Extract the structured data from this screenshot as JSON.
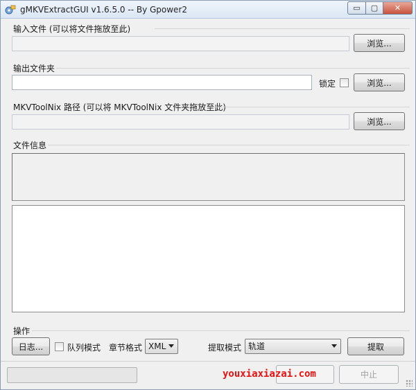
{
  "window": {
    "title": "gMKVExtractGUI v1.6.5.0 -- By Gpower2",
    "controls": {
      "minimize": "▭",
      "maximize": "▢",
      "close": "✕"
    }
  },
  "input_group": {
    "title": "输入文件 (可以将文件拖放至此)",
    "value": "",
    "browse": "浏览..."
  },
  "output_group": {
    "title": "输出文件夹",
    "value": "",
    "lock_label": "锁定",
    "lock_checked": false,
    "browse": "浏览..."
  },
  "mkvtoolnix_group": {
    "title": "MKVToolNix 路径 (可以将 MKVToolNix 文件夹拖放至此)",
    "value": "",
    "browse": "浏览..."
  },
  "file_info_group": {
    "title": "文件信息"
  },
  "actions_group": {
    "title": "操作",
    "log_button": "日志...",
    "queue_mode_label": "队列模式",
    "queue_mode_checked": false,
    "chapter_format_label": "章节格式",
    "chapter_format_value": "XML",
    "extract_mode_label": "提取模式",
    "extract_mode_value": "轨道",
    "extract_button": "提取"
  },
  "status_bar": {
    "progress": 0,
    "add_jobs_button": "",
    "abort_button": "中止",
    "watermark": "youxiaxiazai.com"
  },
  "colors": {
    "accent": "#06b025",
    "close": "#c7523c",
    "watermark": "#e8110f"
  }
}
